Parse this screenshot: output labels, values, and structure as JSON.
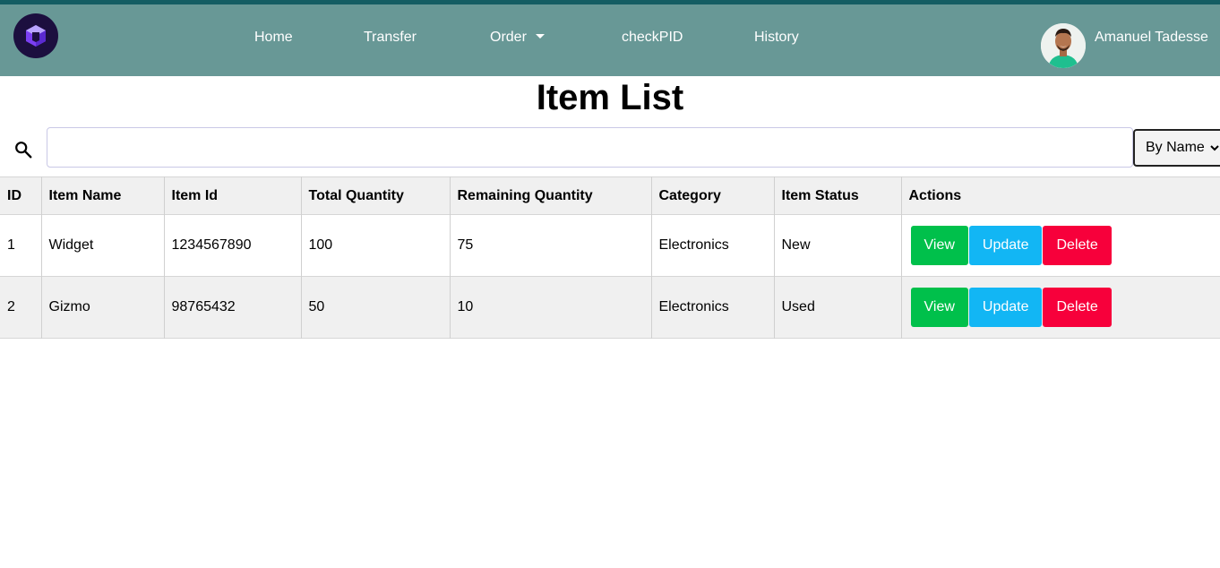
{
  "nav": {
    "links": [
      "Home",
      "Transfer",
      "Order",
      "checkPID",
      "History"
    ],
    "user_name": "Amanuel Tadesse"
  },
  "page": {
    "title": "Item List"
  },
  "search": {
    "value": "",
    "placeholder": "",
    "filter_selected": "By Name"
  },
  "table": {
    "headers": [
      "ID",
      "Item Name",
      "Item Id",
      "Total Quantity",
      "Remaining Quantity",
      "Category",
      "Item Status",
      "Actions"
    ],
    "rows": [
      [
        "1",
        "Widget",
        "1234567890",
        "100",
        "75",
        "Electronics",
        "New"
      ],
      [
        "2",
        "Gizmo",
        "98765432",
        "50",
        "10",
        "Electronics",
        "Used"
      ]
    ],
    "actions": {
      "view": "View",
      "update": "Update",
      "delete": "Delete"
    }
  },
  "colors": {
    "navbar": "#689896",
    "topline": "#145d63",
    "view_button": "#00c04b",
    "update_button": "#12b6f4",
    "delete_button": "#f7003b"
  },
  "icons": [
    "logo-cube-icon",
    "caret-down-icon",
    "search-icon",
    "chevron-down-icon"
  ]
}
